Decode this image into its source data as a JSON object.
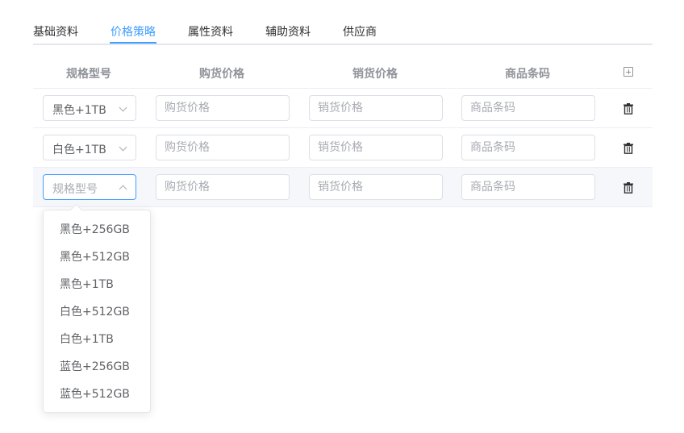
{
  "tabs": [
    {
      "label": "基础资料"
    },
    {
      "label": "价格策略"
    },
    {
      "label": "属性资料"
    },
    {
      "label": "辅助资料"
    },
    {
      "label": "供应商"
    }
  ],
  "active_tab": "价格策略",
  "table": {
    "headers": {
      "spec": "规格型号",
      "purchase_price": "购货价格",
      "sale_price": "销货价格",
      "barcode": "商品条码"
    },
    "add_column_icon": "plus-square-icon",
    "delete_icon": "trash-icon",
    "rows": [
      {
        "spec": "黑色+1TB",
        "spec_placeholder": "规格型号",
        "purchase_placeholder": "购货价格",
        "sale_placeholder": "销货价格",
        "barcode_placeholder": "商品条码"
      },
      {
        "spec": "白色+1TB",
        "spec_placeholder": "规格型号",
        "purchase_placeholder": "购货价格",
        "sale_placeholder": "销货价格",
        "barcode_placeholder": "商品条码"
      },
      {
        "spec": "",
        "spec_placeholder": "规格型号",
        "purchase_placeholder": "购货价格",
        "sale_placeholder": "销货价格",
        "barcode_placeholder": "商品条码"
      }
    ]
  },
  "dropdown": {
    "options": [
      "黑色+256GB",
      "黑色+512GB",
      "黑色+1TB",
      "白色+512GB",
      "白色+1TB",
      "蓝色+256GB",
      "蓝色+512GB"
    ]
  },
  "colors": {
    "accent": "#409eff",
    "text": "#303133",
    "placeholder": "#a8abb2",
    "border": "#dcdfe6",
    "row_hover": "#f5f7fa"
  }
}
